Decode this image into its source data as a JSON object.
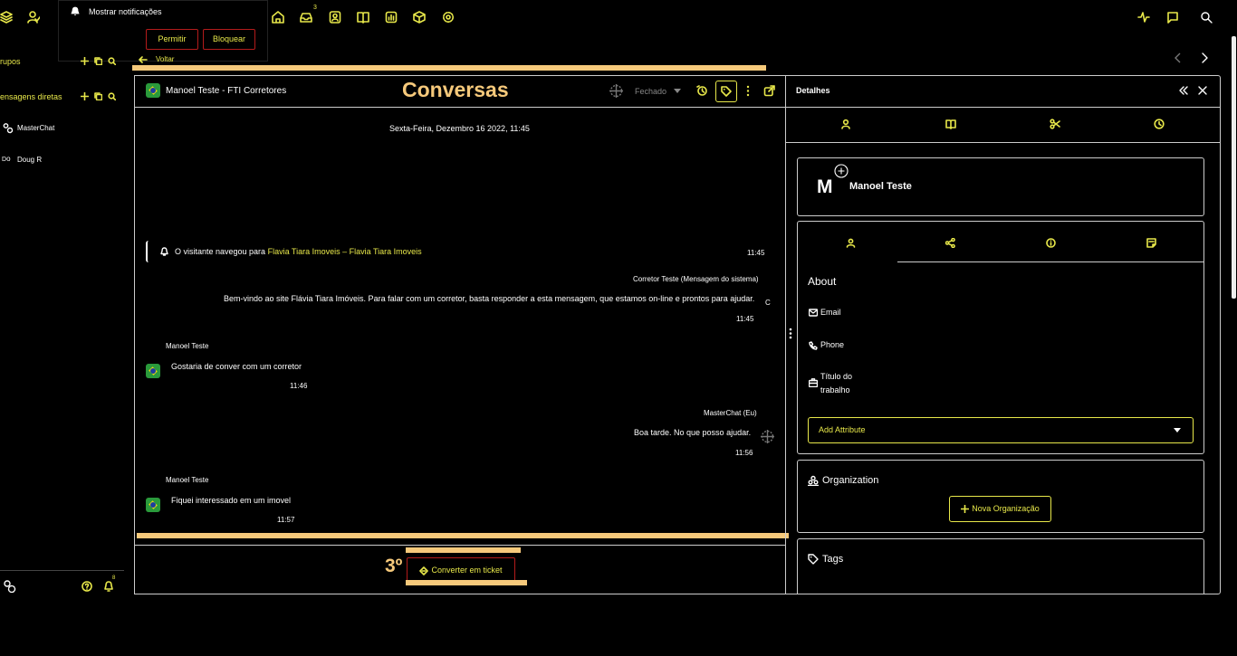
{
  "notification": {
    "label": "Mostrar notificações",
    "allow": "Permitir",
    "block": "Bloquear"
  },
  "topnav": {
    "inbox_badge": "3"
  },
  "sidebar": {
    "groups_label": "rupos",
    "dm_label": "ensagens diretas",
    "users": [
      {
        "name": "MasterChat"
      },
      {
        "name": "Doug R"
      }
    ],
    "bell_badge": "8"
  },
  "back_label": "Voltar",
  "conversation": {
    "title": "Manoel Teste - FTI Corretores",
    "status": "Fechado",
    "date_divider": "Sexta-Feira, Dezembro 16 2022, 11:45",
    "visitor_event": {
      "prefix": "O visitante navegou para ",
      "link": "Flavia Tiara Imoveis – Flavia Tiara Imoveis",
      "time": "11:45"
    },
    "messages": [
      {
        "sender": "Corretor Teste (Mensagem do sistema)",
        "text": "Bem-vindo ao site Flávia Tiara Imóveis. Para falar com um corretor, basta responder a esta mensagem, que estamos on-line e prontos para ajudar.",
        "time": "11:45",
        "avatar": "C"
      },
      {
        "sender": "Manoel Teste",
        "text": "Gostaria de conver com um corretor",
        "time": "11:46"
      },
      {
        "sender": "MasterChat (Eu)",
        "text": "Boa tarde. No que posso ajudar.",
        "time": "11:56"
      },
      {
        "sender": "Manoel Teste",
        "text": "Fiquei interessado em um imovel",
        "time": "11:57"
      }
    ],
    "convert_button": "Converter em ticket"
  },
  "annotations": {
    "title": "Conversas",
    "step": "3º"
  },
  "details": {
    "title": "Detalhes",
    "contact": {
      "initial": "M",
      "name": "Manoel Teste"
    },
    "about": {
      "heading": "About",
      "fields": [
        {
          "label": "Email"
        },
        {
          "label": "Phone"
        },
        {
          "label": "Título do trabalho"
        }
      ],
      "add_attribute": "Add Attribute"
    },
    "organization": {
      "heading": "Organization",
      "button": "Nova Organização"
    },
    "tags": {
      "heading": "Tags"
    }
  },
  "colors": {
    "accent": "#e8e84a",
    "highlight": "#f6c97b",
    "danger": "#b31b1b",
    "annotation": "#f6c97b"
  }
}
